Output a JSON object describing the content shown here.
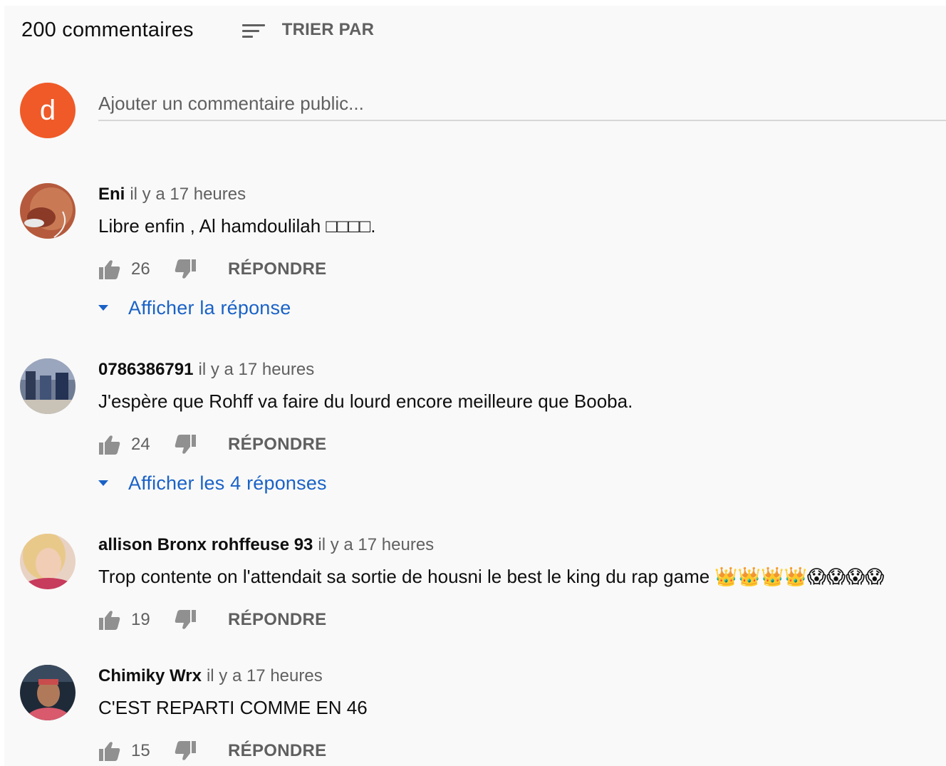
{
  "header": {
    "comment_count": "200 commentaires",
    "sort_label": "TRIER PAR",
    "sort_icon": "sort-icon"
  },
  "add_comment": {
    "avatar_letter": "d",
    "placeholder": "Ajouter un commentaire public...",
    "avatar_color": "#ef5a28"
  },
  "colors": {
    "link_blue": "#1a62c7",
    "secondary_text": "#606060",
    "primary_text": "#0f0f0f",
    "background": "#f9f9f9"
  },
  "comments": [
    {
      "author": "Eni",
      "time": "il y a 17 heures",
      "text": "Libre enfin , Al hamdoulilah □□□□.",
      "likes": "26",
      "reply_label": "RÉPONDRE",
      "replies_label": "Afficher la réponse"
    },
    {
      "author": "0786386791",
      "time": "il y a 17 heures",
      "text": "J'espère que Rohff va faire du lourd encore meilleure que Booba.",
      "likes": "24",
      "reply_label": "RÉPONDRE",
      "replies_label": "Afficher les 4 réponses"
    },
    {
      "author": "allison Bronx rohffeuse 93",
      "time": "il y a 17 heures",
      "text": "Trop contente on l'attendait sa sortie de housni le best le king du rap game 👑👑👑👑😱😱😱😱",
      "likes": "19",
      "reply_label": "RÉPONDRE"
    },
    {
      "author": "Chimiky Wrx",
      "time": "il y a 17 heures",
      "text": "C'EST REPARTI COMME EN 46",
      "likes": "15",
      "reply_label": "RÉPONDRE"
    }
  ]
}
